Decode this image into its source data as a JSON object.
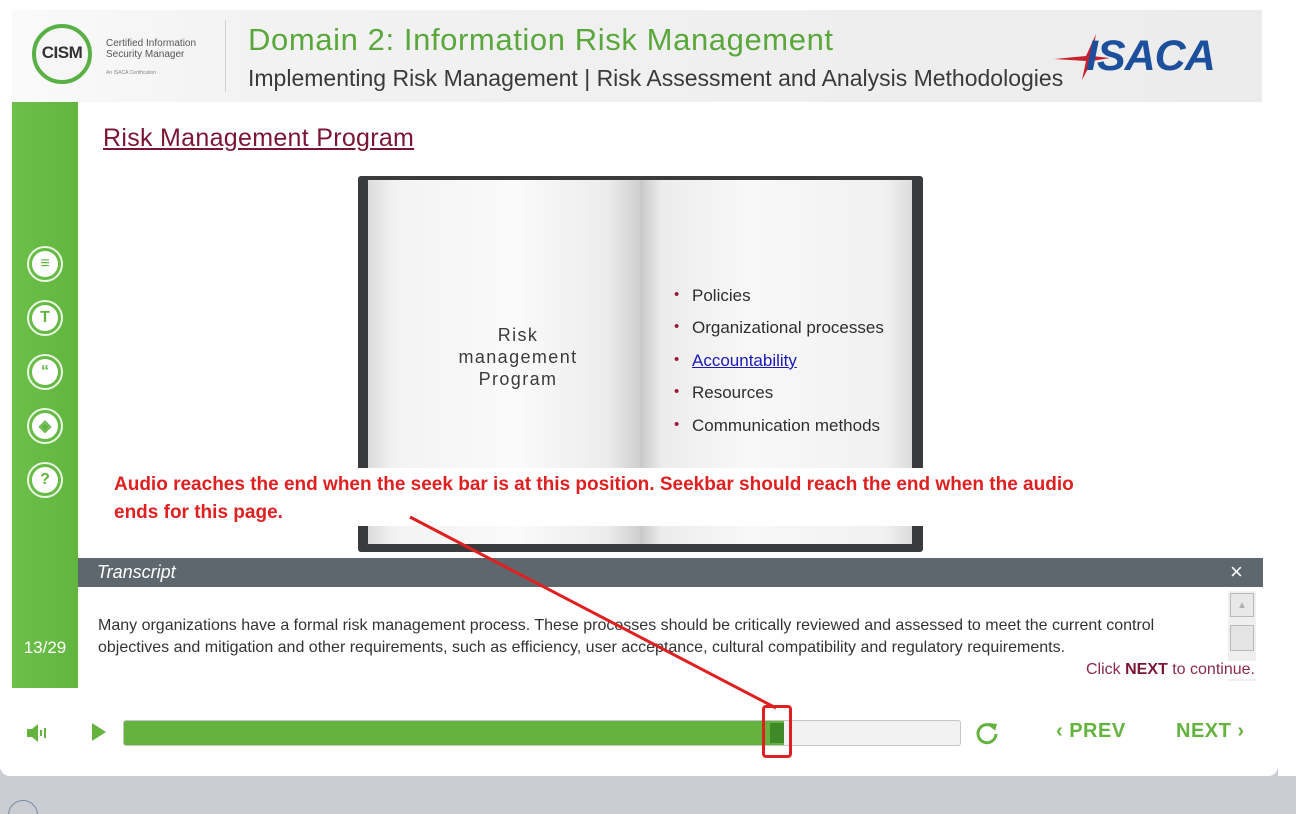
{
  "header": {
    "logo_acronym": "CISM",
    "logo_subtitle": "Certified Information Security Manager",
    "logo_tagline": "An ISACA Certification",
    "title": "Domain 2: Information Risk Management",
    "subtitle": "Implementing Risk Management | Risk Assessment and Analysis Methodologies",
    "brand": "ISACA"
  },
  "sidebar": {
    "buttons": [
      {
        "icon": "notes-icon",
        "glyph": "≡"
      },
      {
        "icon": "topics-icon",
        "glyph": "T"
      },
      {
        "icon": "quote-icon",
        "glyph": "“"
      },
      {
        "icon": "layers-icon",
        "glyph": "◈"
      },
      {
        "icon": "help-icon",
        "glyph": "?"
      }
    ],
    "page_counter": "13/29"
  },
  "slide": {
    "title": "Risk Management Program",
    "book_label": "Risk management Program",
    "bullets": [
      "Policies",
      "Organizational processes",
      "Accountability",
      "Resources",
      "Communication methods"
    ],
    "bullet_link_index": 2
  },
  "annotation": {
    "text": "Audio reaches the end when the seek bar is at this position. Seekbar should reach the end when the audio ends for this page."
  },
  "transcript": {
    "title": "Transcript",
    "close_glyph": "×",
    "text": "Many organizations have a formal risk management process. These processes should be critically reviewed and assessed to meet the current control objectives and mitigation and other requirements, such as efficiency, user acceptance, cultural compatibility and regulatory requirements.",
    "click_next_prefix": "Click ",
    "click_next_bold": "NEXT",
    "click_next_suffix": " to continue."
  },
  "controls": {
    "seek_progress": 0.79,
    "prev_label": "PREV",
    "next_label": "NEXT"
  },
  "colors": {
    "brand_green": "#64b33f",
    "title_maroon": "#7a1533",
    "annotation_red": "#e02020",
    "isaca_blue": "#1c4f9c"
  }
}
